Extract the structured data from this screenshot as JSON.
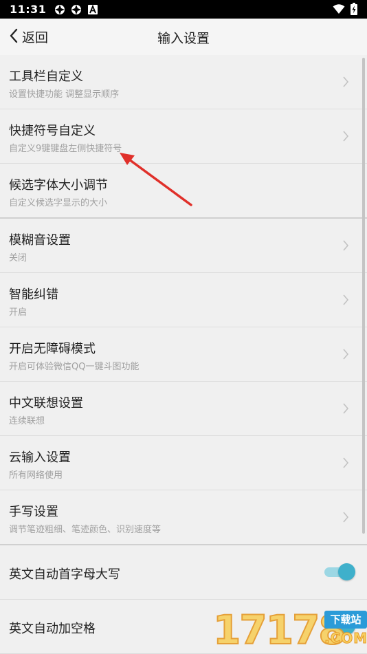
{
  "status_bar": {
    "time": "11:31",
    "left_icons": [
      "sync-icon",
      "sync-icon",
      "a-badge-icon"
    ],
    "right_icons": [
      "wifi-icon",
      "battery-charging-icon"
    ]
  },
  "header": {
    "back_label": "返回",
    "title": "输入设置"
  },
  "settings": [
    {
      "title": "工具栏自定义",
      "subtitle": "设置快捷功能 调整显示顺序",
      "control": "chevron"
    },
    {
      "title": "快捷符号自定义",
      "subtitle": "自定义9键键盘左侧快捷符号",
      "control": "chevron"
    },
    {
      "title": "候选字体大小调节",
      "subtitle": "自定义候选字显示的大小",
      "control": "none"
    },
    {
      "title": "模糊音设置",
      "subtitle": "关闭",
      "control": "chevron"
    },
    {
      "title": "智能纠错",
      "subtitle": "开启",
      "control": "chevron"
    },
    {
      "title": "开启无障碍模式",
      "subtitle": "开启可体验微信QQ一键斗图功能",
      "control": "chevron"
    },
    {
      "title": "中文联想设置",
      "subtitle": "连续联想",
      "control": "chevron"
    },
    {
      "title": "云输入设置",
      "subtitle": "所有网络使用",
      "control": "chevron"
    },
    {
      "title": "手写设置",
      "subtitle": "调节笔迹粗细、笔迹颜色、识别速度等",
      "control": "chevron"
    },
    {
      "title": "英文自动首字母大写",
      "control": "toggle",
      "toggle_on": true
    },
    {
      "title": "英文自动加空格",
      "control": "toggle",
      "toggle_on": true
    }
  ],
  "colors": {
    "accent": "#3fb0cb",
    "annotation_arrow": "#e0302a"
  },
  "watermark": {
    "digits": "17178",
    "badge": "下载站",
    "domain": ".COM"
  }
}
